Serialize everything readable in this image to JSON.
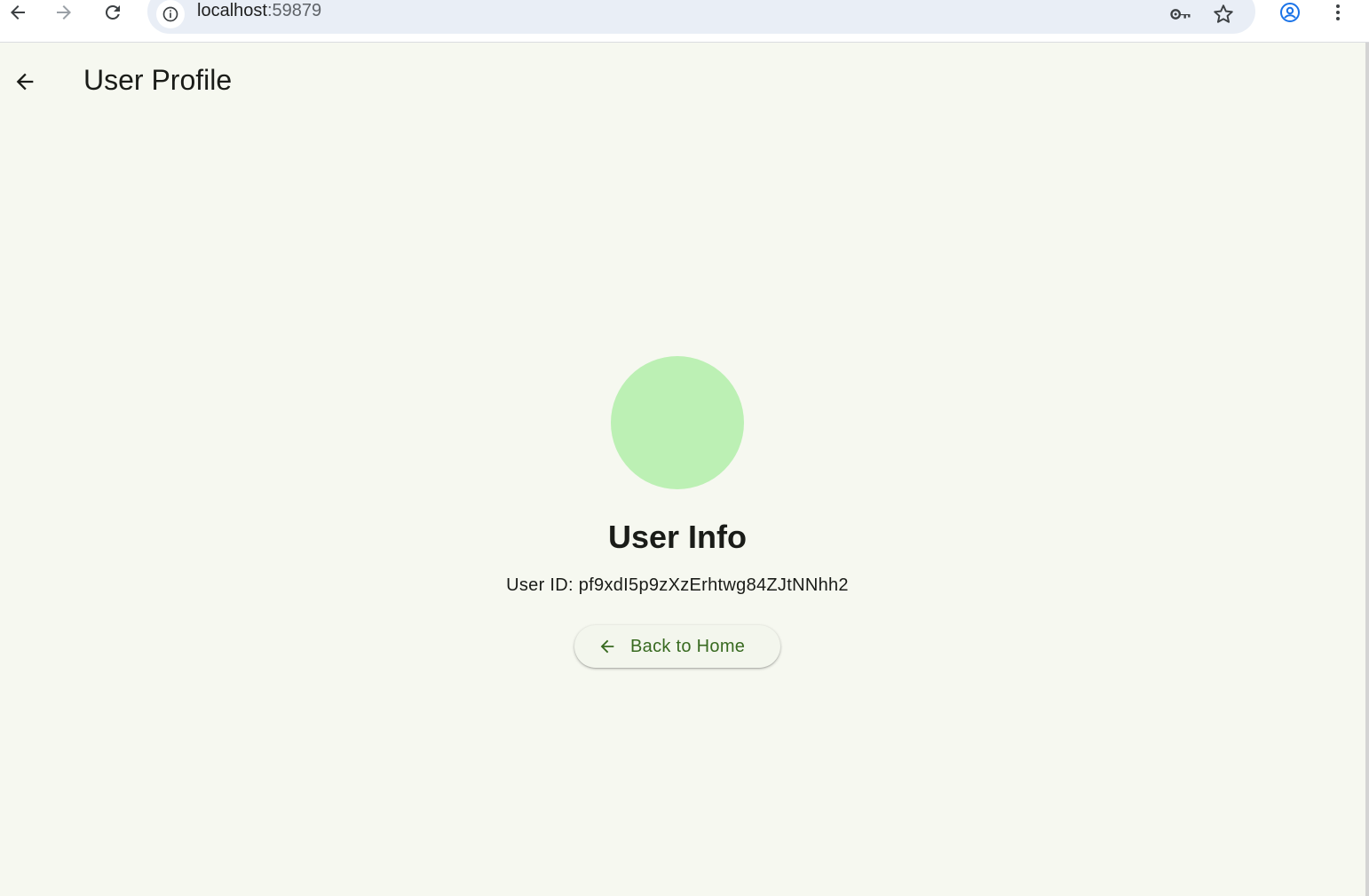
{
  "browser": {
    "url_host": "localhost",
    "url_port": ":59879",
    "accent": "#1a73e8"
  },
  "app_bar": {
    "title": "User Profile",
    "back_icon": "arrow-back-icon"
  },
  "profile": {
    "avatar_color": "#bcf0b4",
    "heading": "User Info",
    "user_id": "User ID: pf9xdI5p9zXzErhtwg84ZJtNNhh2"
  },
  "actions": {
    "back_home_label": "Back to Home",
    "back_home_icon": "arrow-back-icon",
    "button_text_color": "#386a20"
  },
  "colors": {
    "page_background": "#f6f8f0",
    "text": "#1a1c18"
  }
}
